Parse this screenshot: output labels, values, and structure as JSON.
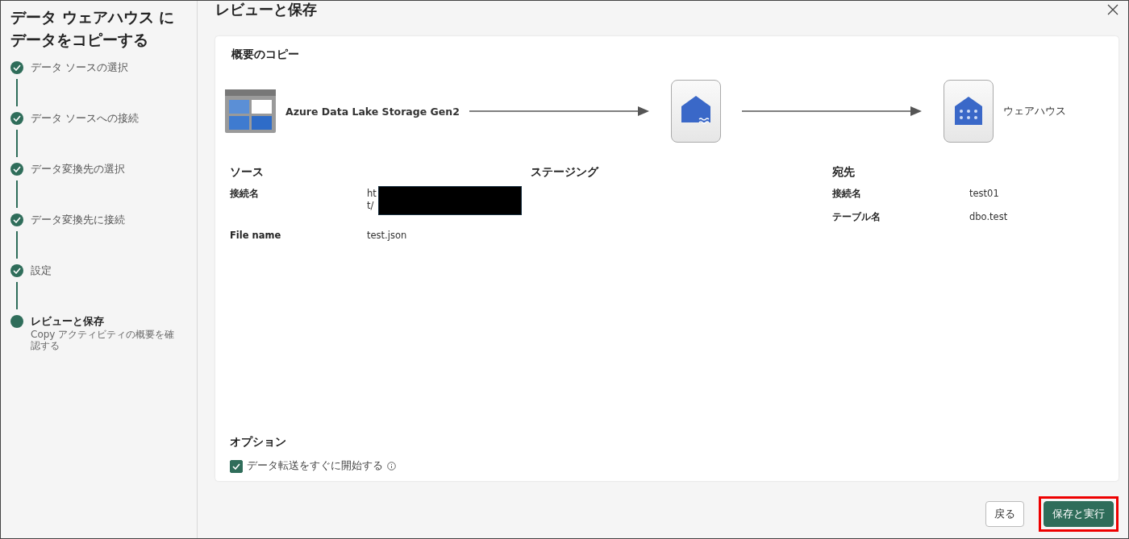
{
  "sidebar": {
    "title": "データ ウェアハウス にデータをコピーする",
    "steps": [
      {
        "label": "データ ソースの選択",
        "completed": true,
        "selected": false
      },
      {
        "label": "データ ソースへの接続",
        "completed": true,
        "selected": false
      },
      {
        "label": "データ変換先の選択",
        "completed": true,
        "selected": false
      },
      {
        "label": "データ変換先に接続",
        "completed": true,
        "selected": false
      },
      {
        "label": "設定",
        "completed": true,
        "selected": false
      },
      {
        "label": "レビューと保存",
        "completed": false,
        "selected": true,
        "description": "Copy アクティビティの概要を確認する"
      }
    ]
  },
  "header": {
    "title": "レビューと保存"
  },
  "summary": {
    "title": "概要のコピー",
    "flow": {
      "source": "Azure Data Lake Storage Gen2",
      "destination": "ウェアハウス"
    },
    "source": {
      "title": "ソース",
      "rows": [
        {
          "label": "接続名",
          "value_lines": [
            "ht",
            "t/"
          ],
          "redacted": true
        },
        {
          "label": "File name",
          "value_lines": [
            "test.json"
          ],
          "redacted": false
        }
      ]
    },
    "staging": {
      "title": "ステージング"
    },
    "destination": {
      "title": "宛先",
      "rows": [
        {
          "label": "接続名",
          "value_lines": [
            "test01"
          ],
          "redacted": false
        },
        {
          "label": "テーブル名",
          "value_lines": [
            "dbo.test"
          ],
          "redacted": false
        }
      ]
    },
    "options": {
      "title": "オプション",
      "items": [
        {
          "label": "データ転送をすぐに開始する",
          "checked": true
        }
      ]
    }
  },
  "footer": {
    "buttons": [
      {
        "label": "戻る",
        "kind": "secondary",
        "highlighted": false
      },
      {
        "label": "保存と実行",
        "kind": "primary",
        "highlighted": true
      }
    ]
  }
}
